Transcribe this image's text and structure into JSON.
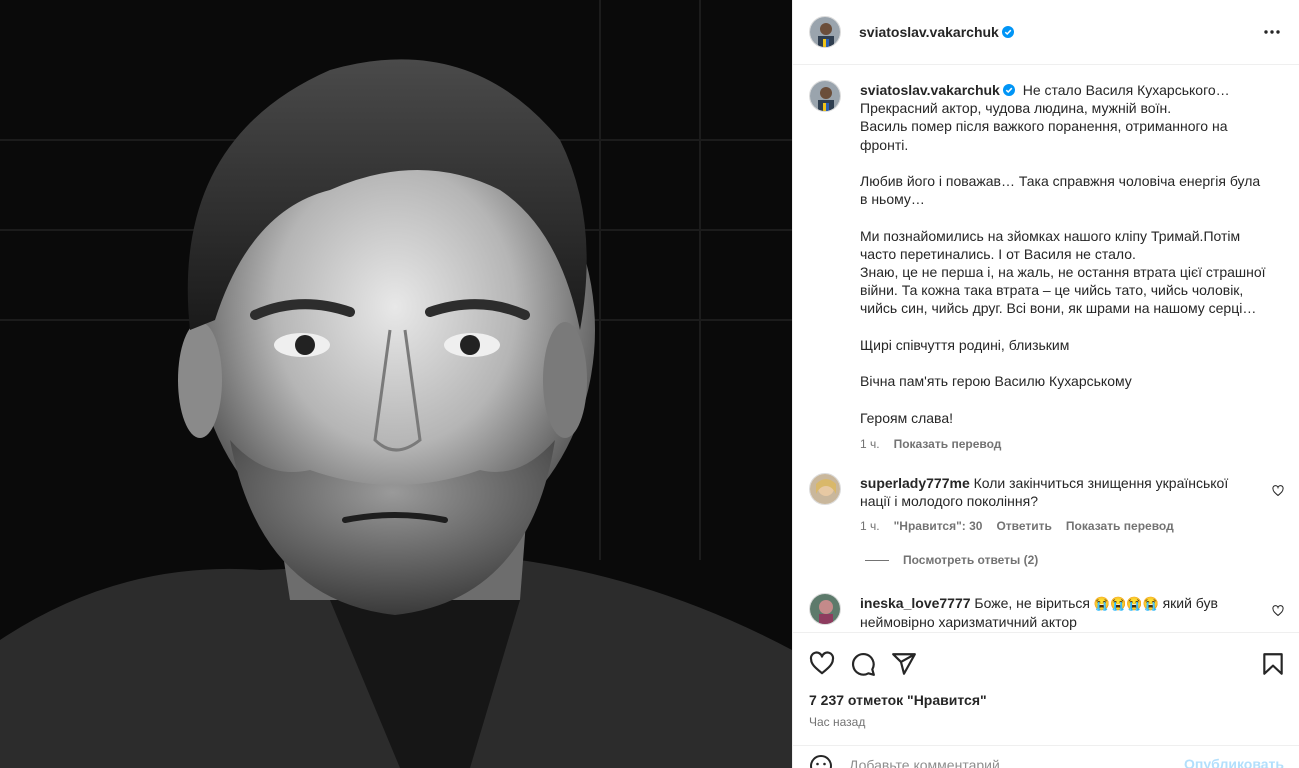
{
  "post": {
    "author": "sviatoslav.vakarchuk",
    "caption_lines": [
      "Не стало Василя Кухарського…",
      "Прекрасний актор, чудова людина, мужній воїн.",
      "Василь помер після важкого поранення, отриманного на",
      "фронті.",
      "",
      "Любив його і поважав… Така справжня чоловіча енергія була",
      "в ньому…",
      "",
      "Ми познайомились на зйомках нашого кліпу Тримай.Потім",
      "часто перетинались. І от Василя не стало.",
      "Знаю, це не перша і, на жаль, не остання втрата цієї страшної",
      "війни. Та кожна така втрата – це чийсь тато, чийсь чоловік,",
      "чийсь син, чийсь друг. Всі вони, як шрами на нашому серці…",
      "",
      "Щирі співчуття родині, близьким",
      "",
      "Вічна пам'ять герою Василю Кухарському",
      "",
      "Героям слава!"
    ],
    "caption_time": "1 ч.",
    "show_translation": "Показать перевод"
  },
  "comments": [
    {
      "user": "superlady777me",
      "text_line1": "Коли закінчиться знищення української",
      "text_line2": "нації і молодого покоління?",
      "time": "1 ч.",
      "likes": "\"Нравится\": 30",
      "reply": "Ответить",
      "translate": "Показать перевод",
      "view_replies": "Посмотреть ответы (2)"
    },
    {
      "user": "ineska_love7777",
      "text_before": "Боже, не віриться",
      "emojis": "😭😭😭😭",
      "text_after": "який був",
      "text_line2": "неймовірно харизматичний актор"
    }
  ],
  "footer": {
    "likes_count": "7 237 отметок \"Нравится\"",
    "time_ago": "Час назад",
    "comment_placeholder": "Добавьте комментарий...",
    "publish": "Опубликовать"
  },
  "icons": {
    "more": "more-horizontal-icon",
    "verified": "verified-badge-icon",
    "like": "heart-icon",
    "comment": "comment-icon",
    "share": "share-icon",
    "save": "bookmark-icon",
    "emoji": "emoji-icon"
  }
}
